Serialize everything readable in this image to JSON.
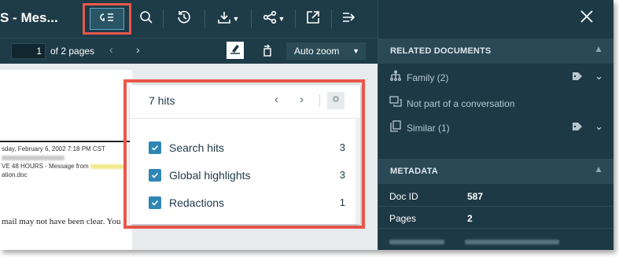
{
  "toolbar": {
    "doc_title": "S - Mes...",
    "buttons": [
      "hits-toggle",
      "search",
      "history",
      "download",
      "share",
      "open-external",
      "exit"
    ]
  },
  "pagebar": {
    "page_value": "1",
    "page_of": "of  2  pages",
    "zoom": "Auto zoom"
  },
  "document": {
    "line1": "sday, February 6, 2002 7:18 PM CST",
    "line3": "VE 48 HOURS - Message from",
    "line4": "ation.doc",
    "body": "mail may not have been clear.  You"
  },
  "hits_popup": {
    "count": "7 hits",
    "rows": [
      {
        "label": "Search hits",
        "count": "3"
      },
      {
        "label": "Global highlights",
        "count": "3"
      },
      {
        "label": "Redactions",
        "count": "1"
      }
    ]
  },
  "related": {
    "title": "RELATED DOCUMENTS",
    "items": [
      {
        "label": "Family (2)"
      },
      {
        "label": "Not part of a conversation"
      },
      {
        "label": "Similar   (1)"
      }
    ]
  },
  "metadata": {
    "title": "METADATA",
    "rows": [
      {
        "key": "Doc ID",
        "value": "587"
      },
      {
        "key": "Pages",
        "value": "2"
      }
    ]
  },
  "colors": {
    "toolbar_bg": "#1e3b48",
    "panel_bg": "#1d3946",
    "highlight_border": "#e8574c",
    "checkbox": "#2f86b5"
  }
}
